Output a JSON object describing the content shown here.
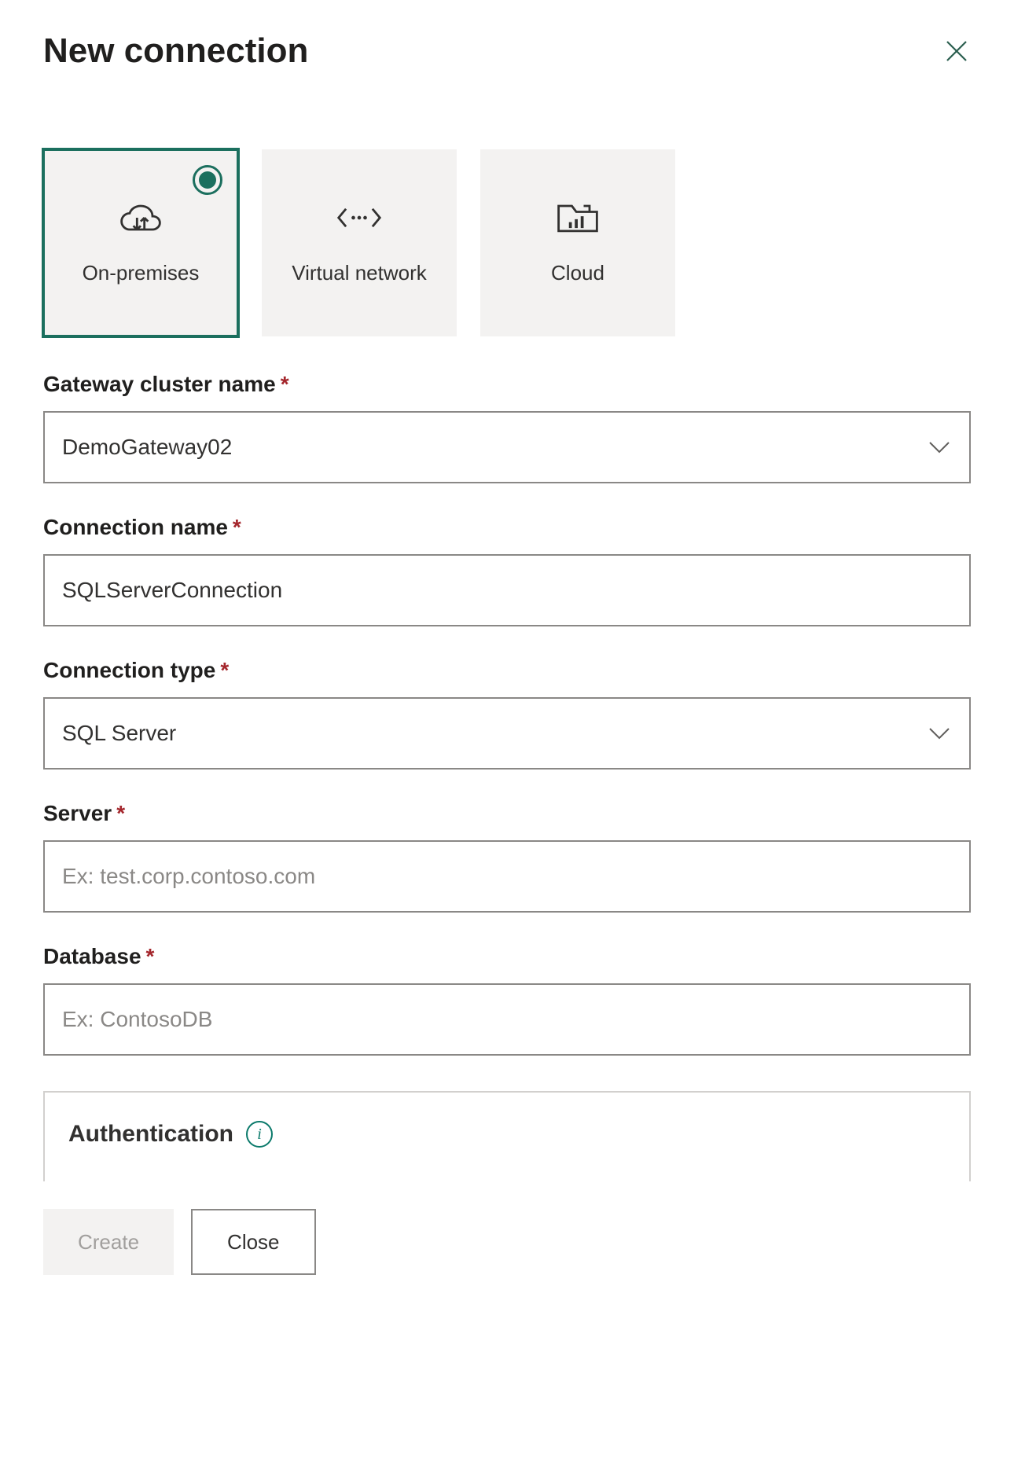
{
  "header": {
    "title": "New connection"
  },
  "connTypes": {
    "onprem": "On-premises",
    "vnet": "Virtual network",
    "cloud": "Cloud"
  },
  "fields": {
    "gatewayCluster": {
      "label": "Gateway cluster name",
      "value": "DemoGateway02"
    },
    "connectionName": {
      "label": "Connection name",
      "value": "SQLServerConnection"
    },
    "connectionType": {
      "label": "Connection type",
      "value": "SQL Server"
    },
    "server": {
      "label": "Server",
      "placeholder": "Ex: test.corp.contoso.com"
    },
    "database": {
      "label": "Database",
      "placeholder": "Ex: ContosoDB"
    }
  },
  "auth": {
    "title": "Authentication"
  },
  "footer": {
    "create": "Create",
    "close": "Close"
  }
}
